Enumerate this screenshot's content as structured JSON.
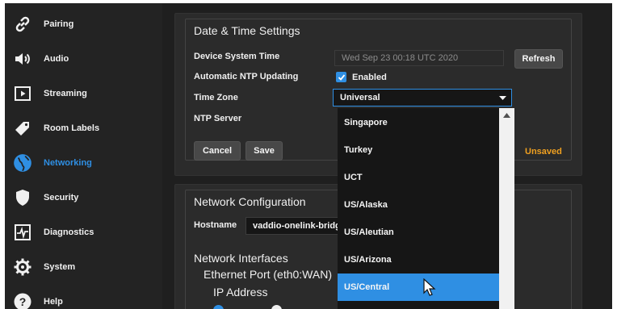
{
  "sidebar": {
    "items": [
      {
        "label": "Pairing",
        "icon": "link-icon"
      },
      {
        "label": "Audio",
        "icon": "speaker-icon"
      },
      {
        "label": "Streaming",
        "icon": "play-icon"
      },
      {
        "label": "Room Labels",
        "icon": "tag-icon"
      },
      {
        "label": "Networking",
        "icon": "globe-icon",
        "active": true
      },
      {
        "label": "Security",
        "icon": "shield-icon"
      },
      {
        "label": "Diagnostics",
        "icon": "pulse-icon"
      },
      {
        "label": "System",
        "icon": "gear-icon"
      },
      {
        "label": "Help",
        "icon": "help-icon"
      }
    ]
  },
  "datetime": {
    "title": "Date & Time Settings",
    "system_time_label": "Device System Time",
    "system_time_value": "Wed Sep 23 00:18 UTC 2020",
    "refresh_label": "Refresh",
    "ntp_label": "Automatic NTP Updating",
    "ntp_enabled_label": "Enabled",
    "timezone_label": "Time Zone",
    "timezone_value": "Universal",
    "ntp_server_label": "NTP Server",
    "cancel_label": "Cancel",
    "save_label": "Save",
    "status_text": "Unsaved"
  },
  "timezone_options": [
    "Singapore",
    "Turkey",
    "UCT",
    "US/Alaska",
    "US/Aleutian",
    "US/Arizona",
    "US/Central"
  ],
  "timezone_highlighted": "US/Central",
  "network": {
    "title": "Network Configuration",
    "hostname_label": "Hostname",
    "hostname_value": "vaddio-onelink-bridge",
    "interfaces_title": "Network Interfaces",
    "ethernet_title": "Ethernet Port (eth0:WAN)",
    "ip_title": "IP Address"
  },
  "colors": {
    "accent": "#2f8fe3",
    "warning": "#f0a020",
    "background": "#1f1f1f"
  }
}
